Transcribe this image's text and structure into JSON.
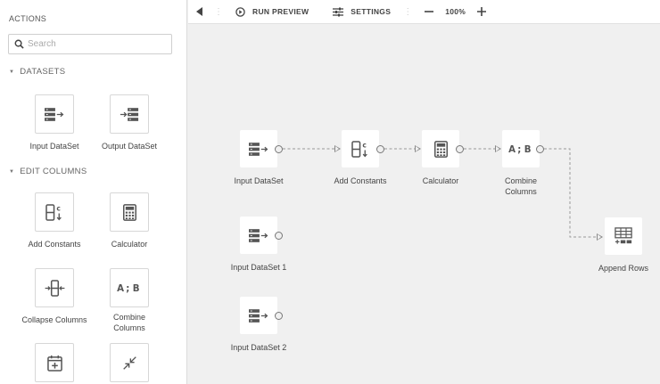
{
  "sidebar": {
    "title": "ACTIONS",
    "search_placeholder": "Search",
    "sections": {
      "datasets": "DATASETS",
      "edit_columns": "EDIT COLUMNS"
    },
    "tools": {
      "input_dataset": "Input DataSet",
      "output_dataset": "Output DataSet",
      "add_constants": "Add Constants",
      "calculator": "Calculator",
      "collapse_columns": "Collapse Columns",
      "combine_columns": "Combine Columns",
      "date_tool": "",
      "collapse_tool": ""
    }
  },
  "toolbar": {
    "run_preview": "RUN PREVIEW",
    "settings": "SETTINGS",
    "zoom": "100%"
  },
  "canvas": {
    "nodes": {
      "input_dataset": "Input DataSet",
      "add_constants": "Add Constants",
      "calculator": "Calculator",
      "combine_columns": "Combine Columns",
      "append_rows": "Append Rows",
      "input_dataset_1": "Input DataSet 1",
      "input_dataset_2": "Input DataSet 2"
    }
  },
  "colors": {
    "icon": "#555555",
    "edge": "#999999",
    "canvas_bg": "#f0f0f0"
  }
}
